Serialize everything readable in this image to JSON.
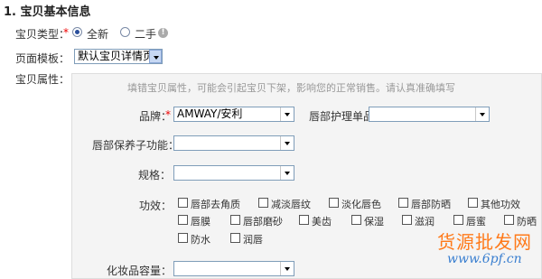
{
  "section": {
    "title": "1. 宝贝基本信息"
  },
  "item_type": {
    "label": "宝贝类型：",
    "required": "*",
    "options": [
      "全新",
      "二手"
    ],
    "selected": "全新",
    "help": "!"
  },
  "page_template": {
    "label": "页面模板：",
    "value": "默认宝贝详情页"
  },
  "attributes": {
    "label": "宝贝属性：",
    "hint": "填错宝贝属性，可能会引起宝贝下架，影响您的正常销售。请认真准确填写",
    "brand": {
      "label": "品牌：",
      "required": "*",
      "value": "AMWAY/安利"
    },
    "lip_care": {
      "label": "唇部护理单品",
      "value": ""
    },
    "lip_function": {
      "label": "唇部保养子功能：",
      "value": ""
    },
    "spec": {
      "label": "规格：",
      "value": ""
    },
    "effects": {
      "label": "功效：",
      "options": [
        "唇部去角质",
        "减淡唇纹",
        "淡化唇色",
        "唇部防晒",
        "其他功效",
        "唇膜",
        "唇部磨砂",
        "美齿",
        "保湿",
        "滋润",
        "唇蜜",
        "防晒",
        "防水",
        "润唇"
      ]
    },
    "capacity": {
      "label": "化妆品容量：",
      "value": ""
    }
  },
  "watermark": {
    "line1": "货源批发网",
    "line2": "www.6pf.cn"
  },
  "colors": {
    "required": "#ee0000",
    "hint": "#999999",
    "watermark_orange": "#ff7a1a",
    "watermark_blue": "#3a7fd0",
    "panel_bg": "#f4f4f4"
  }
}
